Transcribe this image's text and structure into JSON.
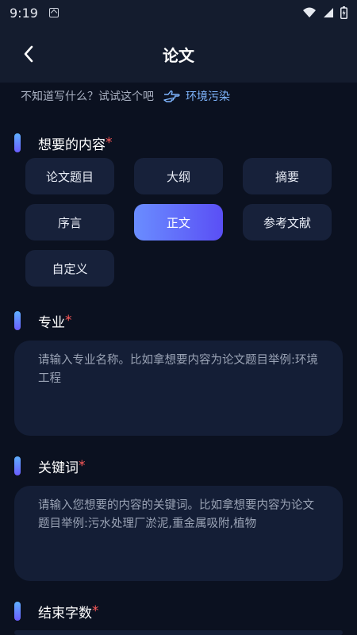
{
  "status_bar": {
    "time": "9:19"
  },
  "header": {
    "title": "论文"
  },
  "hint": {
    "text": "不知道写什么？试试这个吧",
    "suggestion": "环境污染"
  },
  "content_section": {
    "label": "想要的内容",
    "required_mark": "*",
    "options": [
      "论文题目",
      "大纲",
      "摘要",
      "序言",
      "正文",
      "参考文献",
      "自定义"
    ],
    "selected": "正文"
  },
  "major_section": {
    "label": "专业",
    "required_mark": "*",
    "placeholder": "请输入专业名称。比如拿想要内容为论文题目举例:环境工程"
  },
  "keywords_section": {
    "label": "关键词",
    "required_mark": "*",
    "placeholder": "请输入您想要的内容的关键词。比如拿想要内容为论文题目举例:污水处理厂淤泥,重金属吸附,植物"
  },
  "word_count_section": {
    "label": "结束字数",
    "required_mark": "*"
  },
  "colors": {
    "background": "#0b1120",
    "header": "#141c2e",
    "accent_gradient_start": "#6a8dff",
    "accent_gradient_end": "#5a4ff5",
    "required": "#ff5a5a",
    "link": "#7fb6ff"
  }
}
